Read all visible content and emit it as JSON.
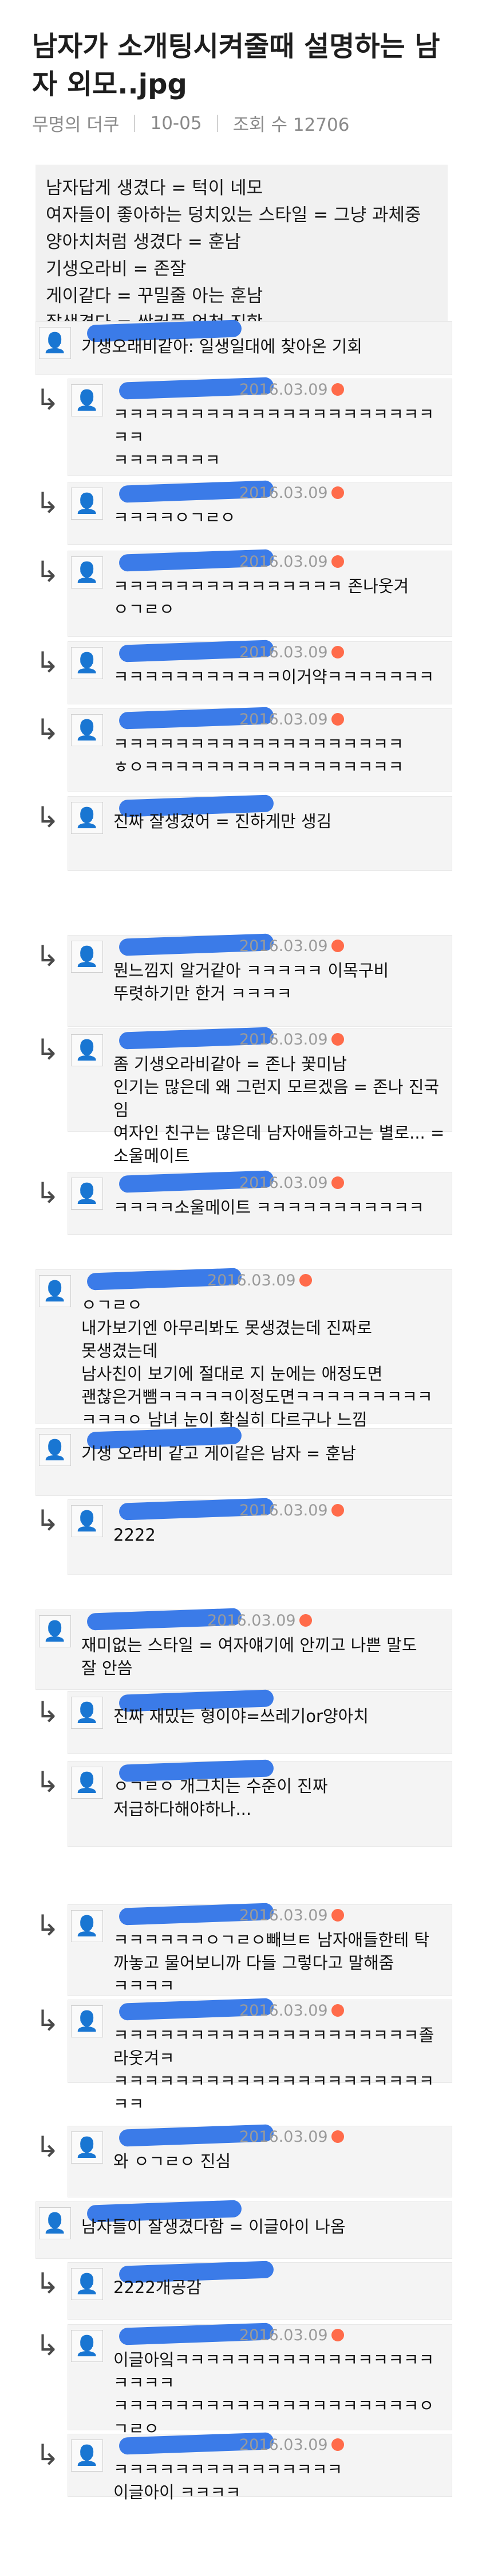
{
  "post": {
    "title": "남자가 소개팅시켜줄때 설명하는 남자 외모..jpg",
    "author": "무명의 더쿠",
    "date": "10-05",
    "views_label": "조회 수 12706"
  },
  "summary": [
    "남자답게 생겼다 = 턱이 네모",
    "여자들이 좋아하는 덩치있는 스타일 = 그냥 과체중",
    "양아치처럼 생겼다 = 훈남",
    "기생오라비 = 존잘",
    "게이같다 = 꾸밀줄 아는 훈남",
    "잘생겼다 = 쌍커풀 엄청 진함"
  ],
  "comments": [
    {
      "text": "기생오래비같아: 일생일대에 찾아온 기회",
      "date": "",
      "reply": false
    },
    {
      "text": "ㅋㅋㅋㅋㅋㅋㅋㅋㅋㅋㅋㅋㅋㅋㅋㅋㅋㅋㅋㅋㅋㅋㅋ\nㅋㅋㅋㅋㅋㅋㅋ",
      "date": "2016.03.09",
      "reply": true
    },
    {
      "text": "ㅋㅋㅋㅋㅇㄱㄹㅇ",
      "date": "2016.03.09",
      "reply": true
    },
    {
      "text": "ㅋㅋㅋㅋㅋㅋㅋㅋㅋㅋㅋㅋㅋㅋㅋ 존나웃겨\nㅇㄱㄹㅇ",
      "date": "2016.03.09",
      "reply": true
    },
    {
      "text": "ㅋㅋㅋㅋㅋㅋㅋㅋㅋㅋㅋ이거약ㅋㅋㅋㅋㅋㅋㅋ",
      "date": "2016.03.09",
      "reply": true
    },
    {
      "text": "ㅋㅋㅋㅋㅋㅋㅋㅋㅋㅋㅋㅋㅋㅋㅋㅋㅋㅋㅋ\nㅎㅇㅋㅋㅋㅋㅋㅋㅋㅋㅋㅋㅋㅋㅋㅋㅋㅋㅋ",
      "date": "2016.03.09",
      "reply": true
    },
    {
      "text": "진짜 잘생겼어 = 진하게만 생김",
      "date": "",
      "reply": true
    },
    {
      "text": "뭔느낌지 알거같아 ㅋㅋㅋㅋㅋ 이목구비\n뚜렷하기만 한거 ㅋㅋㅋㅋ",
      "date": "2016.03.09",
      "reply": true
    },
    {
      "text": "좀 기생오라비같아 = 존나 꽃미남\n인기는 많은데 왜 그런지 모르겠음 = 존나 진국임\n여자인 친구는 많은데 남자애들하고는 별로... =\n소울메이트",
      "date": "2016.03.09",
      "reply": true
    },
    {
      "text": "ㅋㅋㅋㅋ소울메이트 ㅋㅋㅋㅋㅋㅋㅋㅋㅋㅋㅋ",
      "date": "2016.03.09",
      "reply": true
    },
    {
      "text": "ㅇㄱㄹㅇ\n내가보기엔 아무리봐도 못생겼는데 진짜로\n못생겼는데\n남사친이 보기에 절대로 지 눈에는 애정도면\n괜찮은거뺌ㅋㅋㅋㅋㅋ이정도면ㅋㅋㅋㅋㅋㅋㅋㅋㅋ\nㅋㅋㅋㅇ 남녀 눈이 확실히 다르구나 느낌",
      "date": "2016.03.09",
      "reply": false
    },
    {
      "text": "기생 오라비 같고 게이같은 남자 = 훈남",
      "date": "",
      "reply": false
    },
    {
      "text": "2222",
      "date": "2016.03.09",
      "reply": true
    },
    {
      "text": "재미없는 스타일 = 여자얘기에 안끼고 나쁜 말도\n잘 안씀",
      "date": "2016.03.09",
      "reply": false
    },
    {
      "text": "진짜 재밌는 형이야=쓰레기or양아치",
      "date": "",
      "reply": true
    },
    {
      "text": "ㅇㄱㄹㅇ 개그치는 수준이 진짜\n저급하다해야하나...",
      "date": "",
      "reply": true
    },
    {
      "text": "ㅋㅋㅋㅋㅋㅋㅇㄱㄹㅇ빼브ㅌ 남자애들한테 탁\n까놓고 물어보니까 다들 그렇다고 말해줌\nㅋㅋㅋㅋ",
      "date": "2016.03.09",
      "reply": true
    },
    {
      "text": "ㅋㅋㅋㅋㅋㅋㅋㅋㅋㅋㅋㅋㅋㅋㅋㅋㅋㅋㅋㅋ졸라웃겨ㅋ\nㅋㅋㅋㅋㅋㅋㅋㅋㅋㅋㅋㅋㅋㅋㅋㅋㅋㅋㅋㅋㅋㅋㅋ",
      "date": "2016.03.09",
      "reply": true
    },
    {
      "text": "와 ㅇㄱㄹㅇ 진심",
      "date": "2016.03.09",
      "reply": true
    },
    {
      "text": "남자들이 잘생겼다함 = 이글아이 나옴",
      "date": "",
      "reply": false
    },
    {
      "text": "2222개공감",
      "date": "",
      "reply": true
    },
    {
      "text": "이글아잌ㅋㅋㅋㅋㅋㅋㅋㅋㅋㅋㅋㅋㅋㅋㅋㅋㅋㅋㅋㅋㅋ\nㅋㅋㅋㅋㅋㅋㅋㅋㅋㅋㅋㅋㅋㅋㅋㅋㅋㅋㅋㅋㅇㄱㄹㅇ\nㅇㅋㅋㅋㅋㅋㅋㅋㅋㅋㅋ",
      "date": "2016.03.09",
      "reply": true
    },
    {
      "text": "ㅋㅋㅋㅋㅋㅋㅋㅋㅋㅋㅋㅋㅋㅋㅋ\n이글아이 ㅋㅋㅋㅋ",
      "date": "2016.03.09",
      "reply": true
    }
  ]
}
